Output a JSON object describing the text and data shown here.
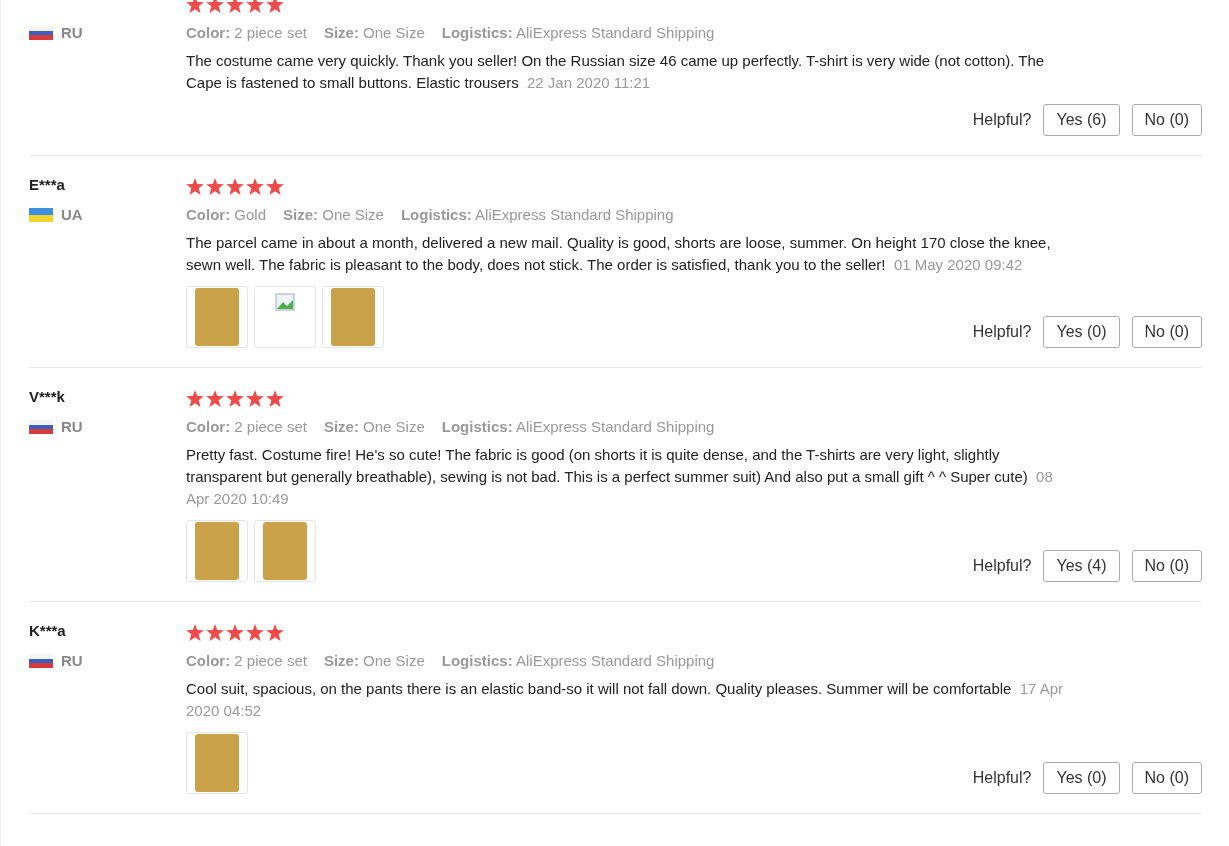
{
  "reviews": [
    {
      "kind": "ru",
      "country": "RU",
      "stars": 5,
      "attributes": [
        {
          "label": "Color:",
          "value": "2 piece set"
        },
        {
          "label": "Size:",
          "value": "One Size"
        },
        {
          "label": "Logistics:",
          "value": "AliExpress Standard Shipping"
        }
      ],
      "text": "The costume came very quickly. Thank you seller! On the Russian size 46 came up perfectly. T-shirt is very wide (not cotton). The Cape is fastened to small buttons. Elastic trousers",
      "date": "22 Jan 2020 11:21",
      "helpful": "Helpful?",
      "yes": "Yes (6)",
      "no": "No (0)"
    },
    {
      "name": "E***a",
      "kind": "ua",
      "country": "UA",
      "stars": 5,
      "attributes": [
        {
          "label": "Color:",
          "value": "Gold"
        },
        {
          "label": "Size:",
          "value": "One Size"
        },
        {
          "label": "Logistics:",
          "value": "AliExpress Standard Shipping"
        }
      ],
      "text": "The parcel came in about a month, delivered a new mail. Quality is good, shorts are loose, summer. On height 170 close the knee, sewn well. The fabric is pleasant to the body, does not stick. The order is satisfied, thank you to the seller!",
      "date": "01 May 2020 09:42",
      "photos": [
        {
          "kind": "photo"
        },
        {
          "kind": "broken"
        },
        {
          "kind": "photo"
        }
      ],
      "helpful": "Helpful?",
      "yes": "Yes (0)",
      "no": "No (0)"
    },
    {
      "name": "V***k",
      "kind": "ru",
      "country": "RU",
      "stars": 5,
      "attributes": [
        {
          "label": "Color:",
          "value": "2 piece set"
        },
        {
          "label": "Size:",
          "value": "One Size"
        },
        {
          "label": "Logistics:",
          "value": "AliExpress Standard Shipping"
        }
      ],
      "text": "Pretty fast. Costume fire! He's so cute! The fabric is good (on shorts it is quite dense, and the T-shirts are very light, slightly transparent but generally breathable), sewing is not bad. This is a perfect summer suit) And also put a small gift ^ ^ Super cute)",
      "date": "08 Apr 2020 10:49",
      "photos": [
        {
          "kind": "photo"
        },
        {
          "kind": "photo"
        }
      ],
      "helpful": "Helpful?",
      "yes": "Yes (4)",
      "no": "No (0)"
    },
    {
      "name": "K***a",
      "kind": "ru",
      "country": "RU",
      "stars": 5,
      "attributes": [
        {
          "label": "Color:",
          "value": "2 piece set"
        },
        {
          "label": "Size:",
          "value": "One Size"
        },
        {
          "label": "Logistics:",
          "value": "AliExpress Standard Shipping"
        }
      ],
      "text": "Cool suit, spacious, on the pants there is an elastic band-so it will not fall down. Quality pleases. Summer will be comfortable",
      "date": "17 Apr 2020 04:52",
      "photos": [
        {
          "kind": "photo"
        }
      ],
      "helpful": "Helpful?",
      "yes": "Yes (0)",
      "no": "No (0)"
    }
  ]
}
